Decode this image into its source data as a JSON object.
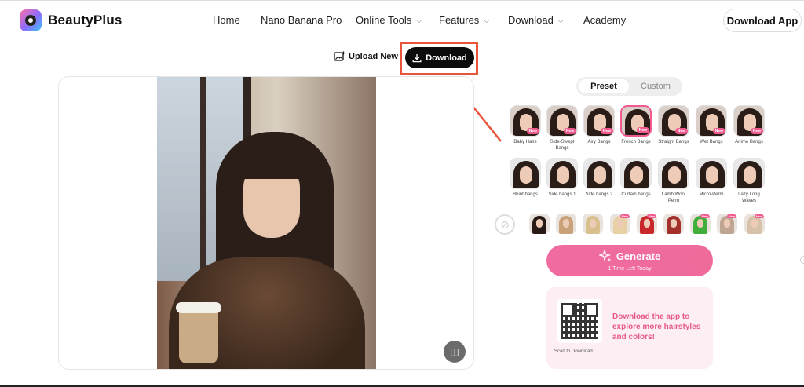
{
  "header": {
    "brand": "BeautyPlus",
    "nav": [
      {
        "label": "Home",
        "has_menu": false
      },
      {
        "label": "Nano Banana Pro",
        "has_menu": false
      },
      {
        "label": "Online Tools",
        "has_menu": true
      },
      {
        "label": "Features",
        "has_menu": true
      },
      {
        "label": "Download",
        "has_menu": true
      },
      {
        "label": "Academy",
        "has_menu": false
      }
    ],
    "download_app": "Download App"
  },
  "toolbar": {
    "upload_new": "Upload New",
    "download": "Download"
  },
  "panel": {
    "tabs": {
      "preset": "Preset",
      "custom": "Custom"
    },
    "styles_row1": [
      {
        "label": "Baby Hairs",
        "new": true
      },
      {
        "label": "Side-Swept Bangs",
        "new": true
      },
      {
        "label": "Airy Bangs",
        "new": true
      },
      {
        "label": "French Bangs",
        "new": true,
        "selected": true
      },
      {
        "label": "Straight Bangs",
        "new": true
      },
      {
        "label": "Wet Bangs",
        "new": true
      },
      {
        "label": "Anime Bangs",
        "new": true
      }
    ],
    "styles_row2": [
      {
        "label": "Blunt bangs",
        "new": false
      },
      {
        "label": "Side bangs 1",
        "new": false
      },
      {
        "label": "Side bangs 2",
        "new": false
      },
      {
        "label": "Curtain bangs",
        "new": false
      },
      {
        "label": "Lamb Wool Perm",
        "new": false
      },
      {
        "label": "Micro-Perm",
        "new": false
      },
      {
        "label": "Lazy Long Waves",
        "new": false
      }
    ],
    "new_badge": "New",
    "colors": [
      {
        "hex": "#2a1a16",
        "new": false
      },
      {
        "hex": "#c9a27a",
        "new": false
      },
      {
        "hex": "#d8c08e",
        "new": false
      },
      {
        "hex": "#e8cfa4",
        "new": true
      },
      {
        "hex": "#c8282a",
        "new": true
      },
      {
        "hex": "#a3302a",
        "new": false
      },
      {
        "hex": "#3fae3a",
        "new": true
      },
      {
        "hex": "#bfa592",
        "new": true
      },
      {
        "hex": "#d6c2a8",
        "new": true
      }
    ],
    "generate": {
      "label": "Generate",
      "sub": "1 Time Left Today"
    },
    "promo": {
      "text": "Download the app to explore more hairstyles and colors!",
      "scan": "Scan to Download"
    }
  },
  "colors": {
    "accent": "#ef5b8f",
    "highlight": "#e8553a"
  }
}
